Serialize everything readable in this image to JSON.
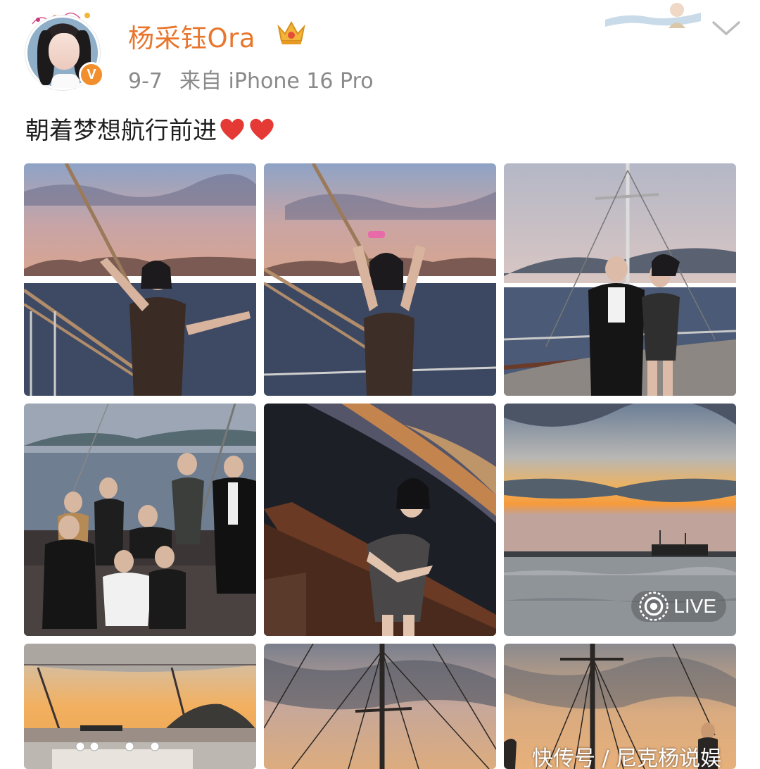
{
  "post": {
    "username": "杨采钰Ora",
    "date": "9-7",
    "source": "来自 iPhone 16 Pro",
    "text": "朝着梦想航行前进",
    "verified_badge": "V",
    "live_label": "LIVE"
  },
  "watermark": "快传号 / 尼克杨说娱",
  "colors": {
    "username": "#e8762d",
    "meta": "#8a8a8a",
    "verified": "#f28f2c",
    "heart": "#e53935"
  },
  "icons": [
    "crown-icon",
    "chevron-down-icon",
    "heart-icon",
    "live-icon"
  ]
}
